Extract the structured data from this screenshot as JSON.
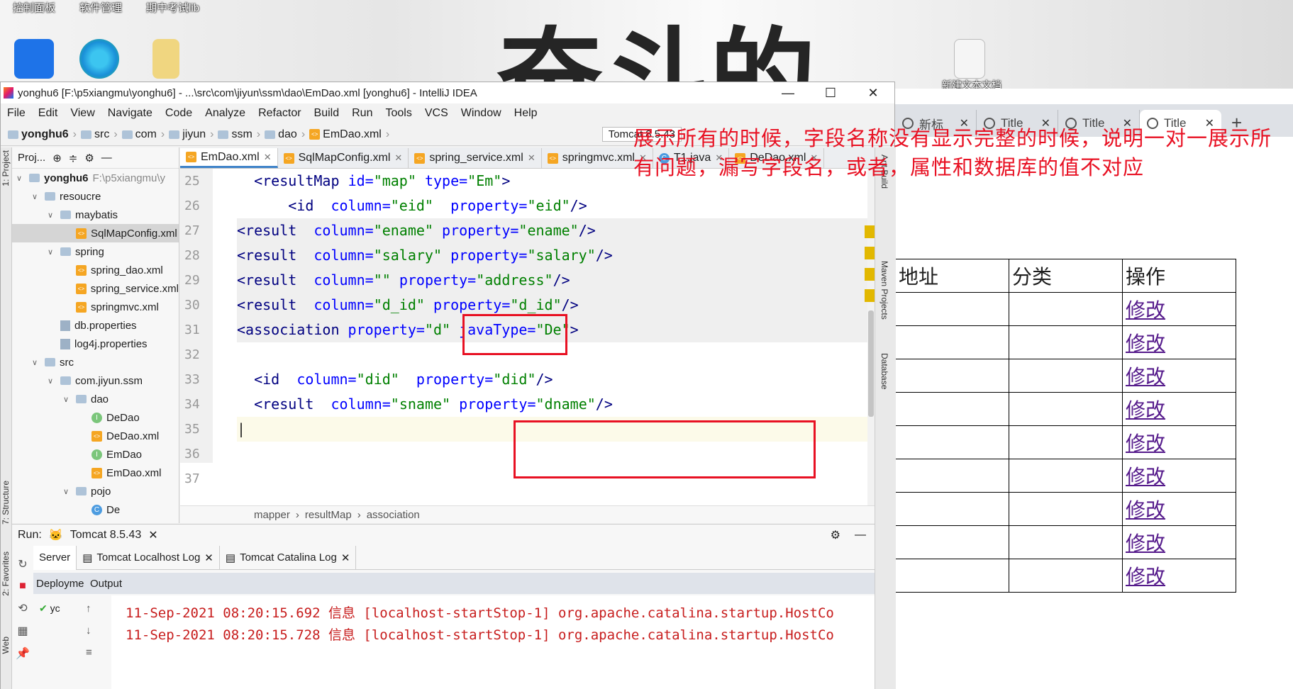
{
  "desktop": {
    "top_links": [
      "控制面板",
      "软件管理",
      "期中考试lib"
    ],
    "background_text": "奋斗的",
    "new_text_doc": "新建文本文档"
  },
  "ide": {
    "title": "yonghu6 [F:\\p5xiangmu\\yonghu6] - ...\\src\\com\\jiyun\\ssm\\dao\\EmDao.xml [yonghu6] - IntelliJ IDEA",
    "menu": [
      "File",
      "Edit",
      "View",
      "Navigate",
      "Code",
      "Analyze",
      "Refactor",
      "Build",
      "Run",
      "Tools",
      "VCS",
      "Window",
      "Help"
    ],
    "nav_path": [
      "yonghu6",
      "src",
      "com",
      "jiyun",
      "ssm",
      "dao",
      "EmDao.xml"
    ],
    "run_config": "Tomcat 8.5.43",
    "project_header": "Proj...",
    "tree": [
      {
        "label": "yonghu6",
        "extra": "F:\\p5xiangmu\\y",
        "indent": 0,
        "icon": "folder",
        "arrow": "v"
      },
      {
        "label": "resoucre",
        "indent": 1,
        "icon": "folder",
        "arrow": "v"
      },
      {
        "label": "maybatis",
        "indent": 2,
        "icon": "folder",
        "arrow": "v"
      },
      {
        "label": "SqlMapConfig.xml",
        "indent": 3,
        "icon": "xml",
        "arrow": "",
        "selected": true
      },
      {
        "label": "spring",
        "indent": 2,
        "icon": "folder",
        "arrow": "v"
      },
      {
        "label": "spring_dao.xml",
        "indent": 3,
        "icon": "xml",
        "arrow": ""
      },
      {
        "label": "spring_service.xml",
        "indent": 3,
        "icon": "xml",
        "arrow": ""
      },
      {
        "label": "springmvc.xml",
        "indent": 3,
        "icon": "xml",
        "arrow": ""
      },
      {
        "label": "db.properties",
        "indent": 2,
        "icon": "prop",
        "arrow": ""
      },
      {
        "label": "log4j.properties",
        "indent": 2,
        "icon": "prop",
        "arrow": ""
      },
      {
        "label": "src",
        "indent": 1,
        "icon": "folder",
        "arrow": "v"
      },
      {
        "label": "com.jiyun.ssm",
        "indent": 2,
        "icon": "folder",
        "arrow": "v"
      },
      {
        "label": "dao",
        "indent": 3,
        "icon": "folder",
        "arrow": "v"
      },
      {
        "label": "DeDao",
        "indent": 4,
        "icon": "i",
        "arrow": ""
      },
      {
        "label": "DeDao.xml",
        "indent": 4,
        "icon": "xml",
        "arrow": ""
      },
      {
        "label": "EmDao",
        "indent": 4,
        "icon": "i",
        "arrow": ""
      },
      {
        "label": "EmDao.xml",
        "indent": 4,
        "icon": "xml",
        "arrow": ""
      },
      {
        "label": "pojo",
        "indent": 3,
        "icon": "folder",
        "arrow": "v"
      },
      {
        "label": "De",
        "indent": 4,
        "icon": "c",
        "arrow": ""
      }
    ],
    "editor_tabs": [
      "EmDao.xml",
      "SqlMapConfig.xml",
      "spring_service.xml",
      "springmvc.xml",
      "T1.java",
      "DeDao.xml"
    ],
    "line_numbers": [
      "25",
      "26",
      "27",
      "28",
      "29",
      "30",
      "31",
      "32",
      "33",
      "34",
      "35",
      "36",
      "37"
    ],
    "breadcrumbs": [
      "mapper",
      "resultMap",
      "association"
    ],
    "right_tools": [
      "Ant Build",
      "Maven Projects",
      "Database"
    ],
    "left_tools": [
      "1: Project",
      "7: Structure",
      "2: Favorites",
      "Web"
    ],
    "run": {
      "label": "Run:",
      "config": "Tomcat 8.5.43",
      "tabs": [
        "Server",
        "Tomcat Localhost Log",
        "Tomcat Catalina Log"
      ],
      "sub_deploy": "Deployme",
      "sub_output": "Output",
      "deploy_item": "yc",
      "log_lines": [
        "11-Sep-2021 08:20:15.692 信息 [localhost-startStop-1] org.apache.catalina.startup.HostCo",
        "11-Sep-2021 08:20:15.728 信息 [localhost-startStop-1] org.apache.catalina.startup.HostCo"
      ]
    }
  },
  "browser": {
    "tabs": [
      "新标",
      "Title",
      "Title",
      "Title"
    ],
    "new_tab": "+",
    "table_headers": [
      "地址",
      "分类",
      "操作"
    ],
    "row_links": [
      "修改",
      "修改",
      "修改",
      "修改",
      "修改",
      "修改",
      "修改",
      "修改",
      "修改"
    ]
  },
  "annotation": "展示所有的时候，字段名称没有显示完整的时候，说明一对一展示所有问题，漏写字段名，或者，属性和数据库的值不对应",
  "colors": {
    "annotation": "#e81123",
    "xml_tag": "#000080",
    "xml_attr": "#0000ff",
    "xml_value": "#008000",
    "link": "#551a8b"
  }
}
